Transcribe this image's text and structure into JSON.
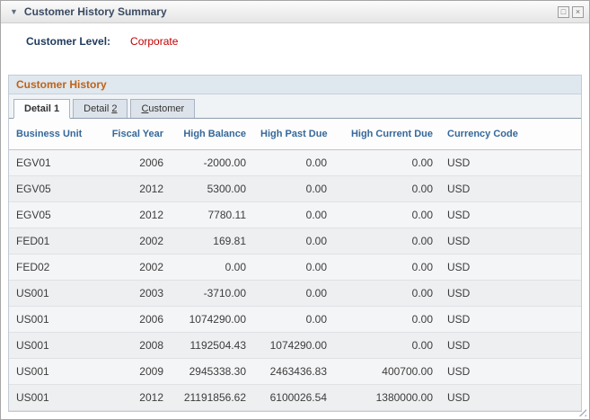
{
  "window": {
    "title": "Customer History Summary",
    "collapse_icon": "▼",
    "restore_glyph": "□",
    "close_glyph": "×"
  },
  "fields": {
    "customer_level_label": "Customer Level:",
    "customer_level_value": "Corporate"
  },
  "section": {
    "title": "Customer History",
    "tabs": [
      {
        "pre": "Detail 1",
        "key": "",
        "post": "",
        "active": true
      },
      {
        "pre": "Detail ",
        "key": "2",
        "post": "",
        "active": false
      },
      {
        "pre": "",
        "key": "C",
        "post": "ustomer",
        "active": false
      }
    ]
  },
  "grid": {
    "columns": [
      "Business Unit",
      "Fiscal Year",
      "High Balance",
      "High Past Due",
      "High Current Due",
      "Currency Code"
    ],
    "numeric_columns": [
      1,
      2,
      3,
      4
    ],
    "rows": [
      [
        "EGV01",
        "2006",
        "-2000.00",
        "0.00",
        "0.00",
        "USD"
      ],
      [
        "EGV05",
        "2012",
        "5300.00",
        "0.00",
        "0.00",
        "USD"
      ],
      [
        "EGV05",
        "2012",
        "7780.11",
        "0.00",
        "0.00",
        "USD"
      ],
      [
        "FED01",
        "2002",
        "169.81",
        "0.00",
        "0.00",
        "USD"
      ],
      [
        "FED02",
        "2002",
        "0.00",
        "0.00",
        "0.00",
        "USD"
      ],
      [
        "US001",
        "2003",
        "-3710.00",
        "0.00",
        "0.00",
        "USD"
      ],
      [
        "US001",
        "2006",
        "1074290.00",
        "0.00",
        "0.00",
        "USD"
      ],
      [
        "US001",
        "2008",
        "1192504.43",
        "1074290.00",
        "0.00",
        "USD"
      ],
      [
        "US001",
        "2009",
        "2945338.30",
        "2463436.83",
        "400700.00",
        "USD"
      ],
      [
        "US001",
        "2012",
        "21191856.62",
        "6100026.54",
        "1380000.00",
        "USD"
      ]
    ]
  },
  "colors": {
    "section_title_orange": "#bf6316",
    "customer_level_red": "#c00000",
    "column_header_blue": "#35689a",
    "title_navy": "#3a4a61"
  }
}
